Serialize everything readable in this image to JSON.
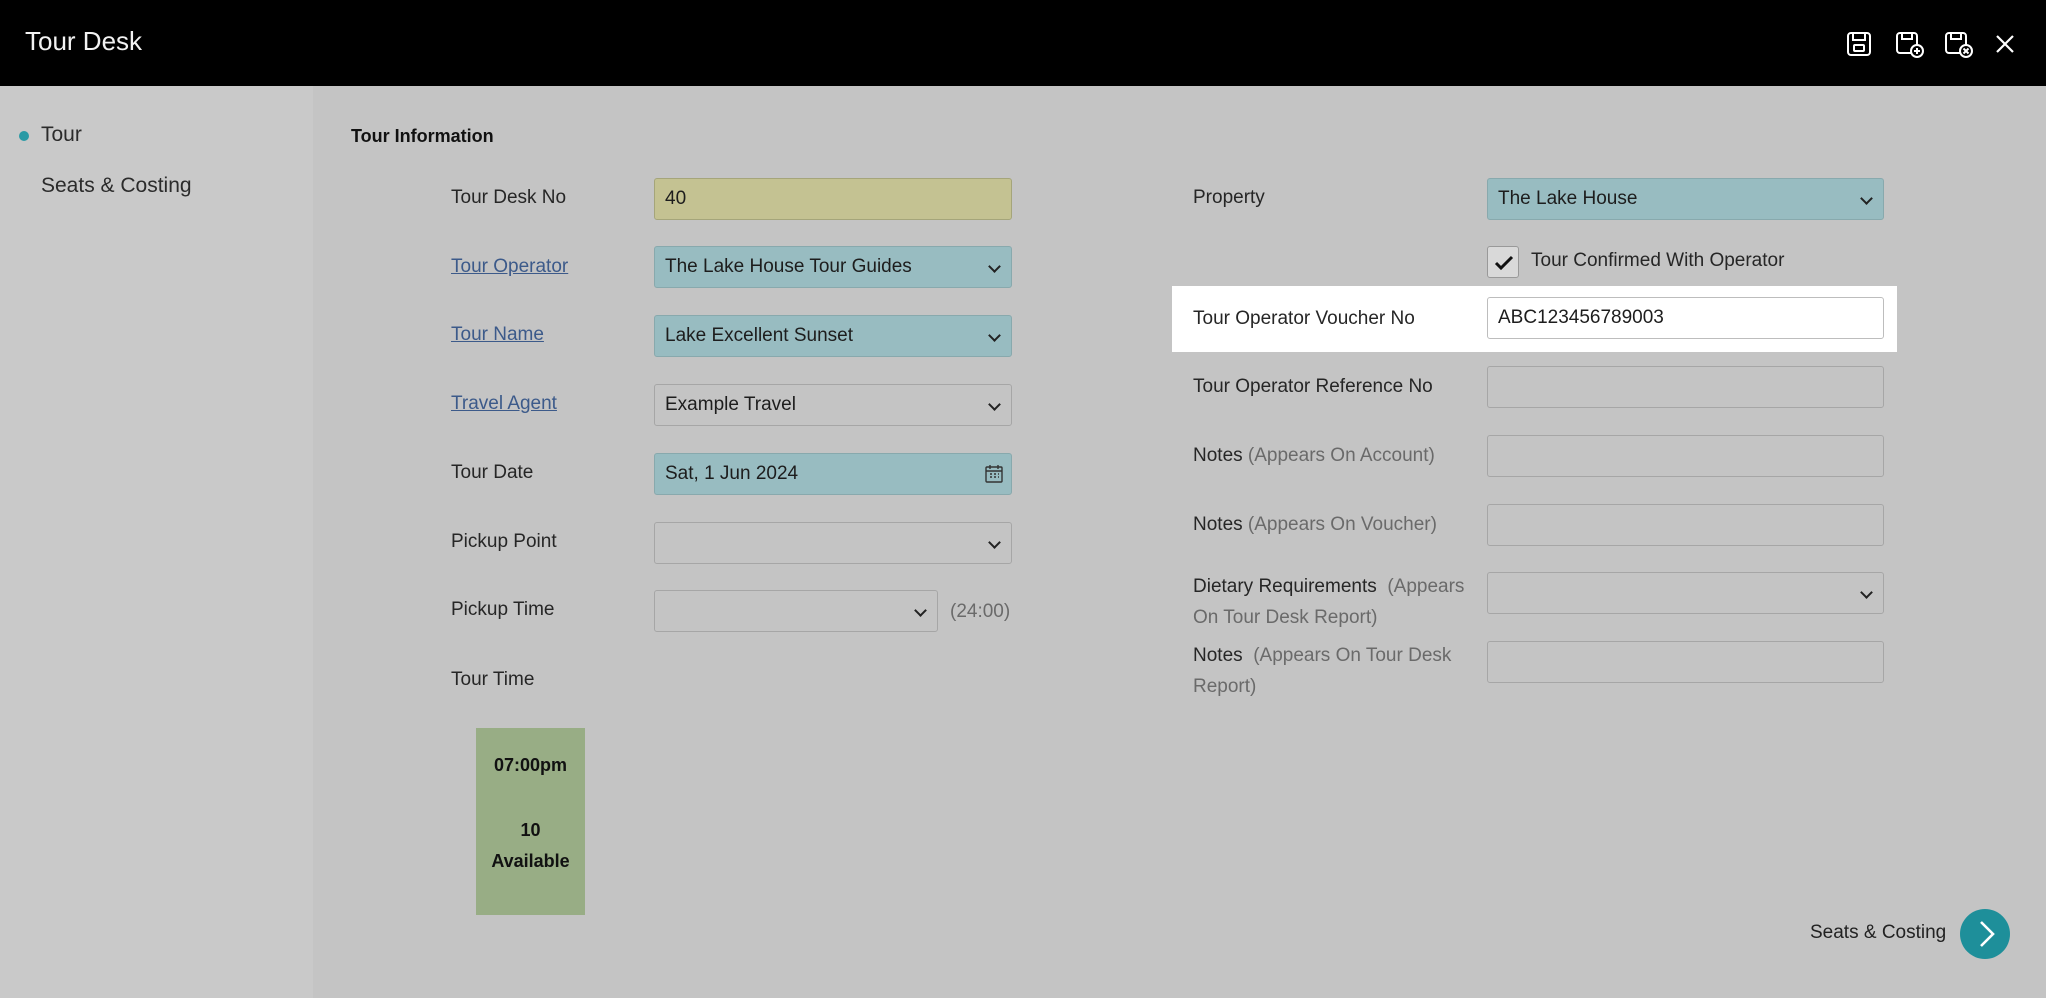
{
  "window": {
    "title": "Tour Desk"
  },
  "toolbar": {
    "icons": [
      "save-icon",
      "save-and-new-icon",
      "save-and-close-icon",
      "close-icon"
    ]
  },
  "sidebar": {
    "items": [
      {
        "label": "Tour",
        "active": true
      },
      {
        "label": "Seats & Costing",
        "active": false
      }
    ]
  },
  "section": {
    "title": "Tour Information"
  },
  "left_form": {
    "tour_desk_no": {
      "label": "Tour Desk No",
      "value": "40"
    },
    "tour_operator": {
      "label": "Tour Operator",
      "value": "The Lake House Tour Guides"
    },
    "tour_name": {
      "label": "Tour Name",
      "value": "Lake Excellent Sunset"
    },
    "travel_agent": {
      "label": "Travel Agent",
      "value": "Example Travel"
    },
    "tour_date": {
      "label": "Tour Date",
      "value": "Sat, 1 Jun 2024"
    },
    "pickup_point": {
      "label": "Pickup Point",
      "value": ""
    },
    "pickup_time": {
      "label": "Pickup Time",
      "value": "",
      "hint": "(24:00)"
    },
    "tour_time": {
      "label": "Tour Time"
    }
  },
  "tour_slot": {
    "time": "07:00pm",
    "count": "10",
    "status": "Available"
  },
  "right_form": {
    "property": {
      "label": "Property",
      "value": "The Lake House"
    },
    "confirmed": {
      "label": "Tour Confirmed With Operator",
      "checked": true
    },
    "voucher_no": {
      "label": "Tour Operator Voucher No",
      "value": "ABC123456789003"
    },
    "reference_no": {
      "label": "Tour Operator Reference No",
      "value": ""
    },
    "notes_account": {
      "label": "Notes",
      "hint": "(Appears On Account)",
      "value": ""
    },
    "notes_voucher": {
      "label": "Notes",
      "hint": "(Appears On Voucher)",
      "value": ""
    },
    "dietary": {
      "label": "Dietary Requirements",
      "hint": "(Appears On Tour Desk Report)",
      "value": ""
    },
    "notes_report": {
      "label": "Notes",
      "hint": "(Appears On Tour Desk Report)",
      "value": ""
    }
  },
  "footer": {
    "next_label": "Seats & Costing"
  },
  "colors": {
    "accent": "#1e8f9a",
    "required_field": "#98bcc1",
    "readonly_field": "#c4c292",
    "slot_available": "#98ad85"
  }
}
